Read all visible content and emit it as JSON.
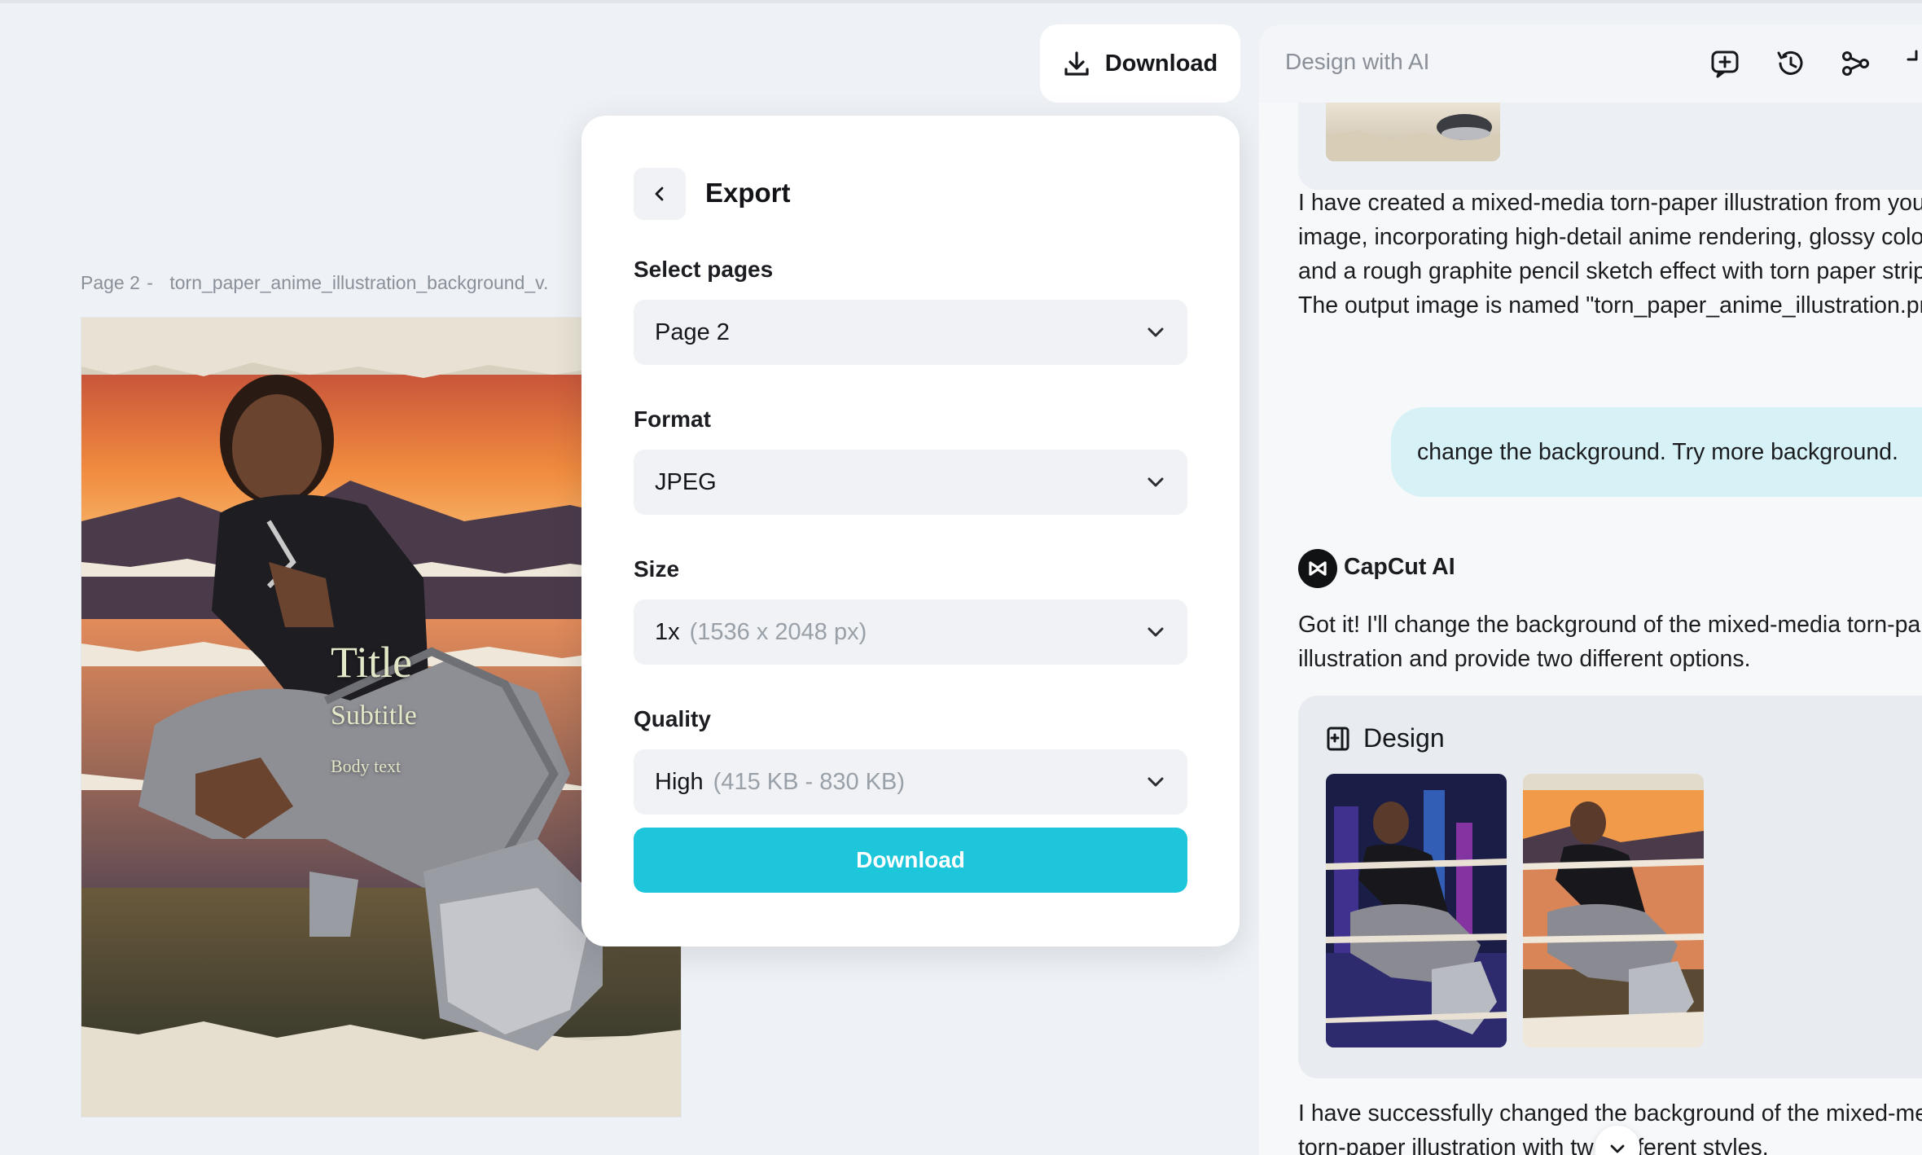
{
  "canvas": {
    "page_label": "Page 2",
    "separator": "-",
    "file_name": "torn_paper_anime_illustration_background_v.",
    "design": {
      "title": "Title",
      "subtitle": "Subtitle",
      "body": "Body text"
    }
  },
  "toolbar": {
    "download_label": "Download",
    "download_icon": "download-icon"
  },
  "export_panel": {
    "title": "Export",
    "back_icon": "chevron-left-icon",
    "select_pages": {
      "label": "Select pages",
      "value": "Page 2"
    },
    "format": {
      "label": "Format",
      "value": "JPEG"
    },
    "size": {
      "label": "Size",
      "value": "1x",
      "detail": "(1536 x 2048 px)"
    },
    "quality": {
      "label": "Quality",
      "value": "High",
      "detail": "(415 KB - 830 KB)"
    },
    "download_label": "Download",
    "accent_color": "#1ec6dc"
  },
  "ai_panel": {
    "title": "Design with AI",
    "header_icons": [
      "new-chat-icon",
      "history-icon",
      "share-icon",
      "collapse-icon"
    ],
    "messages": {
      "ai_message_1": "I have created a mixed-media torn-paper illustration from your image, incorporating high-detail anime rendering, glossy colors, and a rough graphite pencil sketch effect with torn paper strips. The output image is named \"torn_paper_anime_illustration.png\".",
      "user_message": "change the background. Try more background.",
      "assistant_name": "CapCut AI",
      "ai_message_2": "Got it! I'll change the background of the mixed-media torn-paper illustration and provide two different options.",
      "design_card_title": "Design",
      "ai_message_3": "I have successfully changed the background of the mixed-media torn-paper illustration with two different styles."
    },
    "bubble_color": "#d7f2f6"
  }
}
